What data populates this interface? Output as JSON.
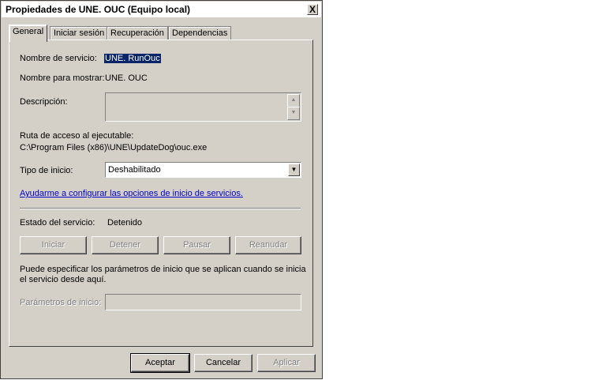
{
  "window": {
    "title": "Propiedades de UNE. OUC (Equipo local)",
    "close_symbol": "X"
  },
  "tabs": [
    {
      "label": "General"
    },
    {
      "label": "Iniciar sesión"
    },
    {
      "label": "Recuperación"
    },
    {
      "label": "Dependencias"
    }
  ],
  "general": {
    "service_name_label": "Nombre de servicio:",
    "service_name_value": "UNE. RunOuc",
    "display_name_label": "Nombre para mostrar:",
    "display_name_value": "UNE. OUC",
    "description_label": "Descripción:",
    "description_value": "",
    "path_label": "Ruta de acceso al ejecutable:",
    "path_value": "C:\\Program Files (x86)\\UNE\\UpdateDog\\ouc.exe",
    "startup_type_label": "Tipo de inicio:",
    "startup_type_value": "Deshabilitado",
    "help_link": "Ayudarme a configurar las opciones de inicio de servicios.",
    "status_label": "Estado del servicio:",
    "status_value": "Detenido",
    "start_button": "Iniciar",
    "stop_button": "Detener",
    "pause_button": "Pausar",
    "resume_button": "Reanudar",
    "params_info": "Puede especificar los parámetros de inicio que se aplican cuando se inicia",
    "params_info_2": "el servicio desde aquí.",
    "params_label": "Parámetros de inicio:",
    "params_value": ""
  },
  "footer": {
    "ok_button": "Aceptar",
    "cancel_button": "Cancelar",
    "apply_button": "Aplicar"
  }
}
